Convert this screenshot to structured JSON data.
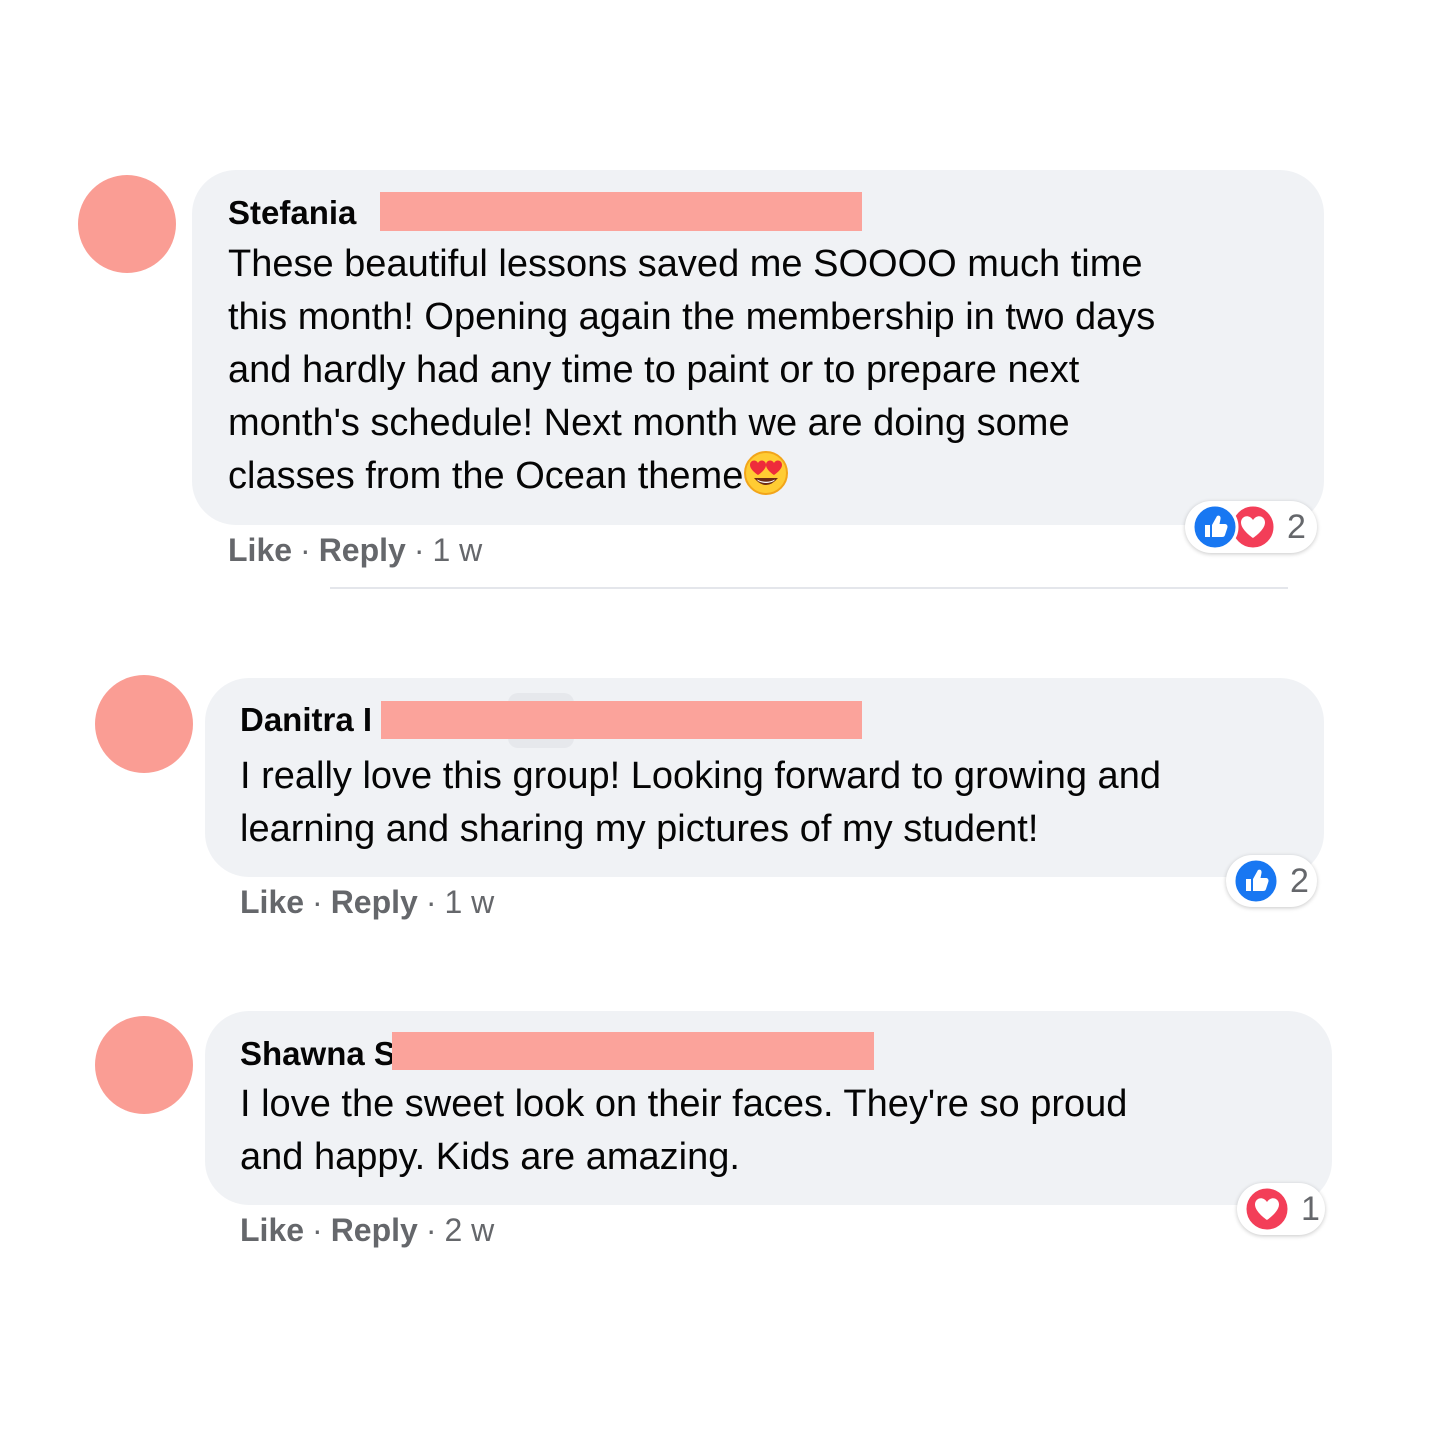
{
  "colors": {
    "bubble": "#f0f2f5",
    "redaction": "#fba39b",
    "avatar": "#fa9d94",
    "meta_text": "#65676b",
    "like_blue": "#1877f2",
    "love_red": "#f33e58"
  },
  "comments": [
    {
      "name": "Stefania",
      "text": "These beautiful lessons saved me SOOOO much time\nthis month! Opening again the membership in two days\nand hardly had any time to paint or to prepare next\nmonth's schedule! Next month we are doing some\nclasses from the Ocean theme",
      "emoji": "heart-eyes-emoji",
      "actions": {
        "like": "Like",
        "reply": "Reply",
        "time": "1 w"
      },
      "reactions": {
        "icons": [
          "like-icon",
          "love-icon"
        ],
        "count": "2"
      }
    },
    {
      "name": "Danitra I",
      "text": "I really love this group! Looking forward to growing and\nlearning and sharing my pictures of my student!",
      "actions": {
        "like": "Like",
        "reply": "Reply",
        "time": "1 w"
      },
      "reactions": {
        "icons": [
          "like-icon"
        ],
        "count": "2"
      }
    },
    {
      "name": "Shawna S",
      "text": "I love the sweet look on their faces. They're so proud\nand happy. Kids are amazing.",
      "actions": {
        "like": "Like",
        "reply": "Reply",
        "time": "2 w"
      },
      "reactions": {
        "icons": [
          "love-icon"
        ],
        "count": "1"
      }
    }
  ]
}
